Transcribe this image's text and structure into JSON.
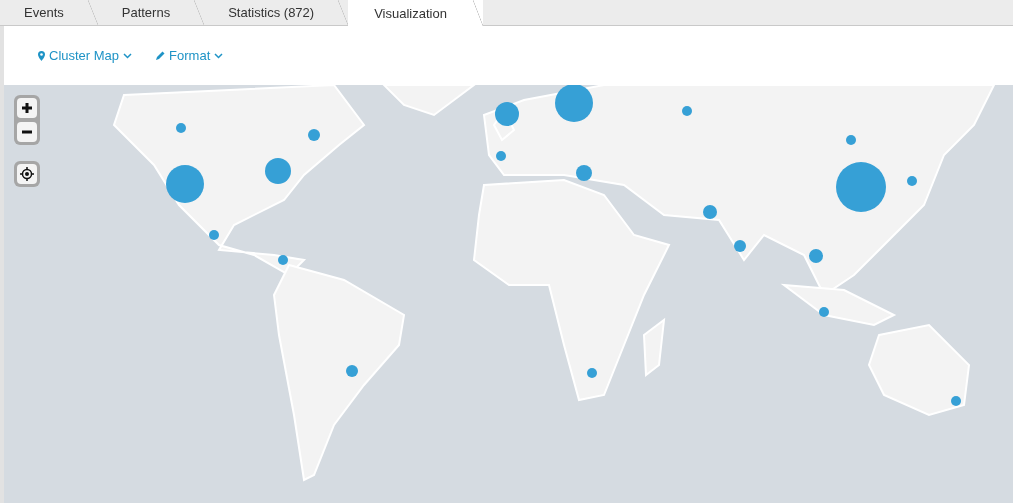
{
  "tabs": [
    {
      "label": "Events",
      "selected": false
    },
    {
      "label": "Patterns",
      "selected": false
    },
    {
      "label": "Statistics (872)",
      "selected": false
    },
    {
      "label": "Visualization",
      "selected": true
    }
  ],
  "toolbar": [
    {
      "kind": "visualization",
      "label": "Cluster Map"
    },
    {
      "kind": "format",
      "label": "Format"
    }
  ]
}
